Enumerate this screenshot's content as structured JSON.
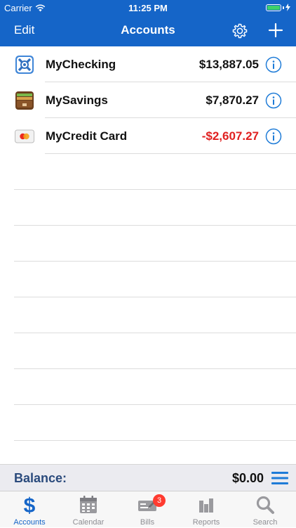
{
  "status_bar": {
    "carrier": "Carrier",
    "time": "11:25 PM"
  },
  "nav": {
    "edit_label": "Edit",
    "title": "Accounts"
  },
  "accounts": [
    {
      "name": "MyChecking",
      "amount": "$13,887.05",
      "icon": "bank-icon"
    },
    {
      "name": "MySavings",
      "amount": "$7,870.27",
      "icon": "wallet-icon"
    },
    {
      "name": "MyCredit Card",
      "amount": "-$2,607.27",
      "icon": "credit-card-icon"
    }
  ],
  "balance": {
    "label": "Balance:",
    "value": "$0.00"
  },
  "tabs": [
    {
      "label": "Accounts",
      "icon": "dollar-icon",
      "active": true
    },
    {
      "label": "Calendar",
      "icon": "calendar-icon"
    },
    {
      "label": "Bills",
      "icon": "checkbook-icon",
      "badge": "3"
    },
    {
      "label": "Reports",
      "icon": "bar-chart-icon"
    },
    {
      "label": "Search",
      "icon": "magnifier-icon"
    }
  ],
  "colors": {
    "brand": "#1565c8",
    "negative": "#e02020",
    "balance_label": "#2a4a7c",
    "badge": "#ff3b30"
  }
}
